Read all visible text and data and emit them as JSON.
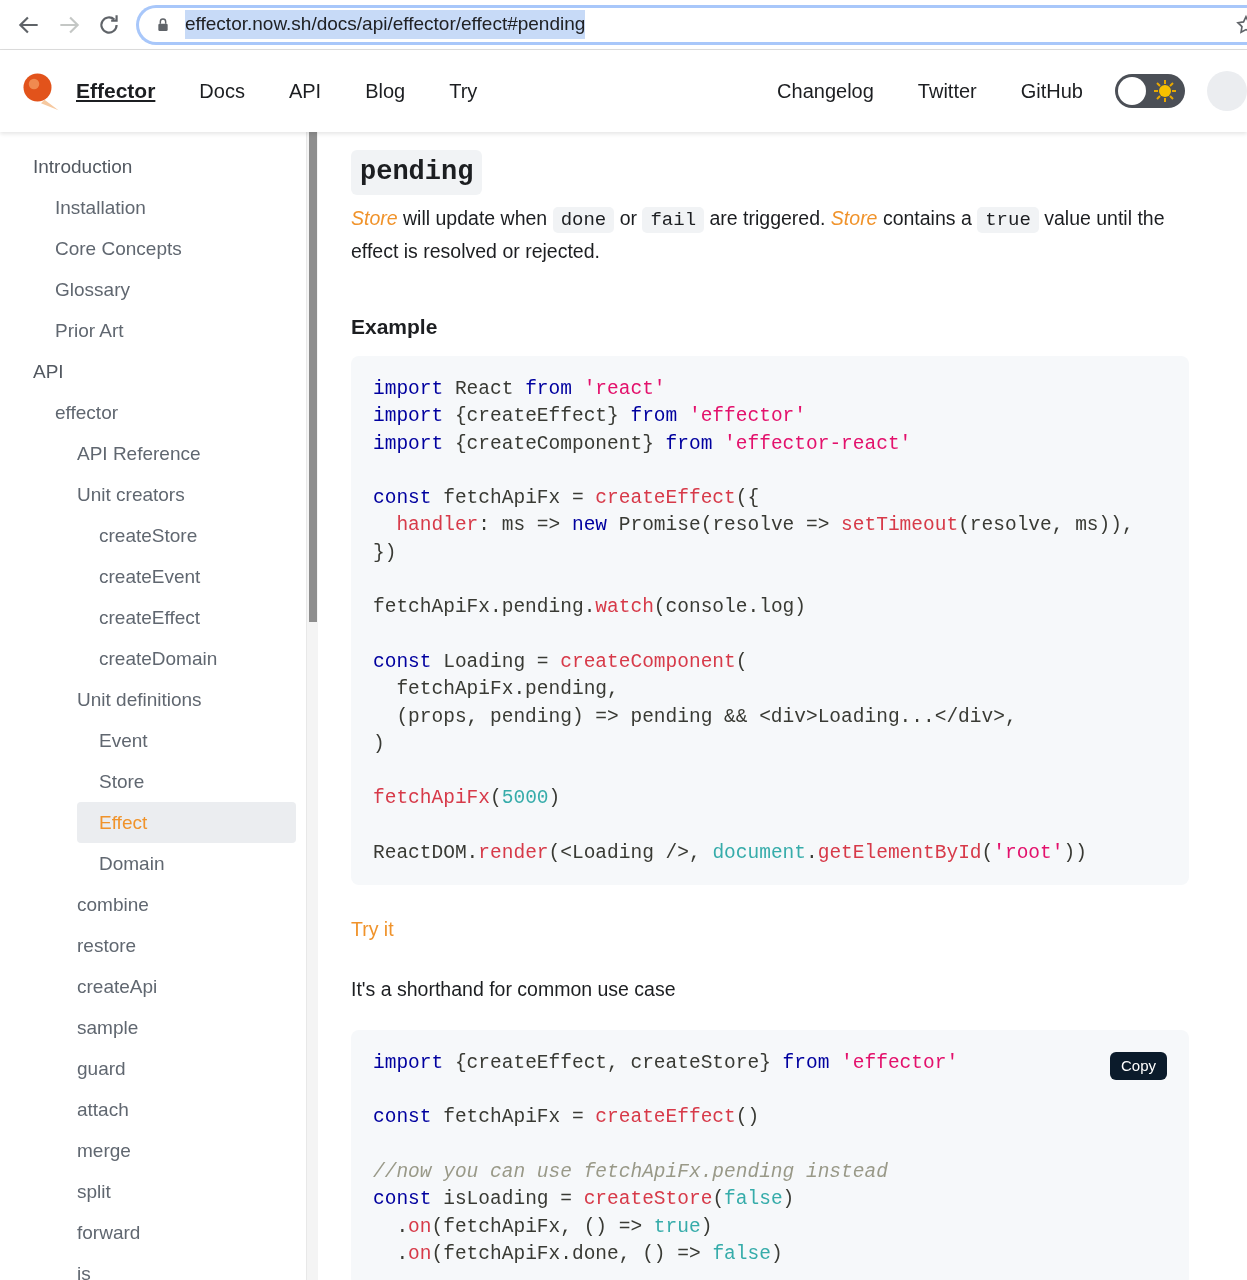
{
  "browser": {
    "url": "effector.now.sh/docs/api/effector/effect#pending",
    "url_selected": true,
    "forward_disabled": true
  },
  "navbar": {
    "brand": "Effector",
    "links": [
      {
        "label": "Docs"
      },
      {
        "label": "API"
      },
      {
        "label": "Blog"
      },
      {
        "label": "Try"
      }
    ],
    "right_links": [
      {
        "label": "Changelog"
      },
      {
        "label": "Twitter"
      },
      {
        "label": "GitHub"
      }
    ],
    "theme_toggle": {
      "checked": false
    }
  },
  "sidebar": {
    "items": [
      {
        "label": "Introduction",
        "selected": false,
        "children": [
          {
            "label": "Installation",
            "selected": false
          },
          {
            "label": "Core Concepts",
            "selected": false
          },
          {
            "label": "Glossary",
            "selected": false
          },
          {
            "label": "Prior Art",
            "selected": false
          }
        ]
      },
      {
        "label": "API",
        "selected": false,
        "children": [
          {
            "label": "effector",
            "selected": false,
            "children": [
              {
                "label": "API Reference",
                "selected": false
              },
              {
                "label": "Unit creators",
                "selected": false,
                "children": [
                  {
                    "label": "createStore",
                    "selected": false
                  },
                  {
                    "label": "createEvent",
                    "selected": false
                  },
                  {
                    "label": "createEffect",
                    "selected": false
                  },
                  {
                    "label": "createDomain",
                    "selected": false
                  }
                ]
              },
              {
                "label": "Unit definitions",
                "selected": false,
                "children": [
                  {
                    "label": "Event",
                    "selected": false
                  },
                  {
                    "label": "Store",
                    "selected": false
                  },
                  {
                    "label": "Effect",
                    "selected": true
                  },
                  {
                    "label": "Domain",
                    "selected": false
                  }
                ]
              },
              {
                "label": "combine",
                "selected": false
              },
              {
                "label": "restore",
                "selected": false
              },
              {
                "label": "createApi",
                "selected": false
              },
              {
                "label": "sample",
                "selected": false
              },
              {
                "label": "guard",
                "selected": false
              },
              {
                "label": "attach",
                "selected": false
              },
              {
                "label": "merge",
                "selected": false
              },
              {
                "label": "split",
                "selected": false
              },
              {
                "label": "forward",
                "selected": false
              },
              {
                "label": "is",
                "selected": false
              }
            ]
          }
        ]
      }
    ]
  },
  "content": {
    "title": "pending",
    "description": [
      {
        "kind": "link",
        "text": "Store"
      },
      {
        "kind": "text",
        "text": " will update when "
      },
      {
        "kind": "code",
        "text": "done"
      },
      {
        "kind": "text",
        "text": " or "
      },
      {
        "kind": "code",
        "text": "fail"
      },
      {
        "kind": "text",
        "text": " are triggered. "
      },
      {
        "kind": "link",
        "text": "Store"
      },
      {
        "kind": "text",
        "text": " contains a "
      },
      {
        "kind": "code",
        "text": "true"
      },
      {
        "kind": "text",
        "text": " value until the effect is resolved or rejected."
      }
    ],
    "example_heading": "Example",
    "code_blocks": [
      {
        "groups": [
          [
            [
              {
                "kind": "kw",
                "text": "import"
              },
              {
                "kind": "plain",
                "text": " React "
              },
              {
                "kind": "kw",
                "text": "from"
              },
              {
                "kind": "str",
                "text": " 'react'"
              }
            ],
            [
              {
                "kind": "kw",
                "text": "import"
              },
              {
                "kind": "plain",
                "text": " {createEffect} "
              },
              {
                "kind": "kw",
                "text": "from"
              },
              {
                "kind": "str",
                "text": " 'effector'"
              }
            ],
            [
              {
                "kind": "kw",
                "text": "import"
              },
              {
                "kind": "plain",
                "text": " {createComponent} "
              },
              {
                "kind": "kw",
                "text": "from"
              },
              {
                "kind": "str",
                "text": " 'effector-react'"
              }
            ]
          ],
          [
            [
              {
                "kind": "kw",
                "text": "const"
              },
              {
                "kind": "plain",
                "text": " fetchApiFx = "
              },
              {
                "kind": "fn",
                "text": "createEffect"
              },
              {
                "kind": "plain",
                "text": "({"
              }
            ],
            [
              {
                "kind": "fn",
                "text": "  handler"
              },
              {
                "kind": "plain",
                "text": ": ms => "
              },
              {
                "kind": "kw",
                "text": "new"
              },
              {
                "kind": "plain",
                "text": " Promise(resolve => "
              },
              {
                "kind": "fn",
                "text": "setTimeout"
              },
              {
                "kind": "plain",
                "text": "(resolve, ms)),"
              }
            ],
            [
              {
                "kind": "plain",
                "text": "})"
              }
            ]
          ],
          [
            [
              {
                "kind": "plain",
                "text": "fetchApiFx.pending."
              },
              {
                "kind": "fn",
                "text": "watch"
              },
              {
                "kind": "plain",
                "text": "(console.log)"
              }
            ]
          ],
          [
            [
              {
                "kind": "kw",
                "text": "const"
              },
              {
                "kind": "plain",
                "text": " Loading = "
              },
              {
                "kind": "fn",
                "text": "createComponent"
              },
              {
                "kind": "plain",
                "text": "("
              }
            ],
            [
              {
                "kind": "plain",
                "text": "  fetchApiFx.pending,"
              }
            ],
            [
              {
                "kind": "plain",
                "text": "  (props, pending) => pending && <div>Loading...</div>,"
              }
            ],
            [
              {
                "kind": "plain",
                "text": ")"
              }
            ]
          ],
          [
            [
              {
                "kind": "fn",
                "text": "fetchApiFx"
              },
              {
                "kind": "plain",
                "text": "("
              },
              {
                "kind": "num",
                "text": "5000"
              },
              {
                "kind": "plain",
                "text": ")"
              }
            ]
          ],
          [
            [
              {
                "kind": "plain",
                "text": "ReactDOM."
              },
              {
                "kind": "fn",
                "text": "render"
              },
              {
                "kind": "plain",
                "text": "(<Loading />, "
              },
              {
                "kind": "num",
                "text": "document"
              },
              {
                "kind": "plain",
                "text": "."
              },
              {
                "kind": "fn",
                "text": "getElementById"
              },
              {
                "kind": "plain",
                "text": "("
              },
              {
                "kind": "str",
                "text": "'root'"
              },
              {
                "kind": "plain",
                "text": "))"
              }
            ]
          ]
        ]
      },
      {
        "copy_label": "Copy",
        "groups": [
          [
            [
              {
                "kind": "kw",
                "text": "import"
              },
              {
                "kind": "plain",
                "text": " {createEffect, createStore} "
              },
              {
                "kind": "kw",
                "text": "from"
              },
              {
                "kind": "str",
                "text": " 'effector'"
              }
            ]
          ],
          [
            [
              {
                "kind": "kw",
                "text": "const"
              },
              {
                "kind": "plain",
                "text": " fetchApiFx = "
              },
              {
                "kind": "fn",
                "text": "createEffect"
              },
              {
                "kind": "plain",
                "text": "()"
              }
            ]
          ],
          [
            [
              {
                "kind": "comment",
                "text": "//now you can use fetchApiFx.pending instead"
              }
            ],
            [
              {
                "kind": "kw",
                "text": "const"
              },
              {
                "kind": "plain",
                "text": " isLoading = "
              },
              {
                "kind": "fn",
                "text": "createStore"
              },
              {
                "kind": "plain",
                "text": "("
              },
              {
                "kind": "num",
                "text": "false"
              },
              {
                "kind": "plain",
                "text": ")"
              }
            ],
            [
              {
                "kind": "plain",
                "text": "  ."
              },
              {
                "kind": "fn",
                "text": "on"
              },
              {
                "kind": "plain",
                "text": "(fetchApiFx, () => "
              },
              {
                "kind": "num",
                "text": "true"
              },
              {
                "kind": "plain",
                "text": ")"
              }
            ],
            [
              {
                "kind": "plain",
                "text": "  ."
              },
              {
                "kind": "fn",
                "text": "on"
              },
              {
                "kind": "plain",
                "text": "(fetchApiFx.done, () => "
              },
              {
                "kind": "num",
                "text": "false"
              },
              {
                "kind": "plain",
                "text": ")"
              }
            ]
          ]
        ]
      }
    ],
    "try_link": "Try it",
    "shorthand_text": "It's a shorthand for common use case"
  }
}
